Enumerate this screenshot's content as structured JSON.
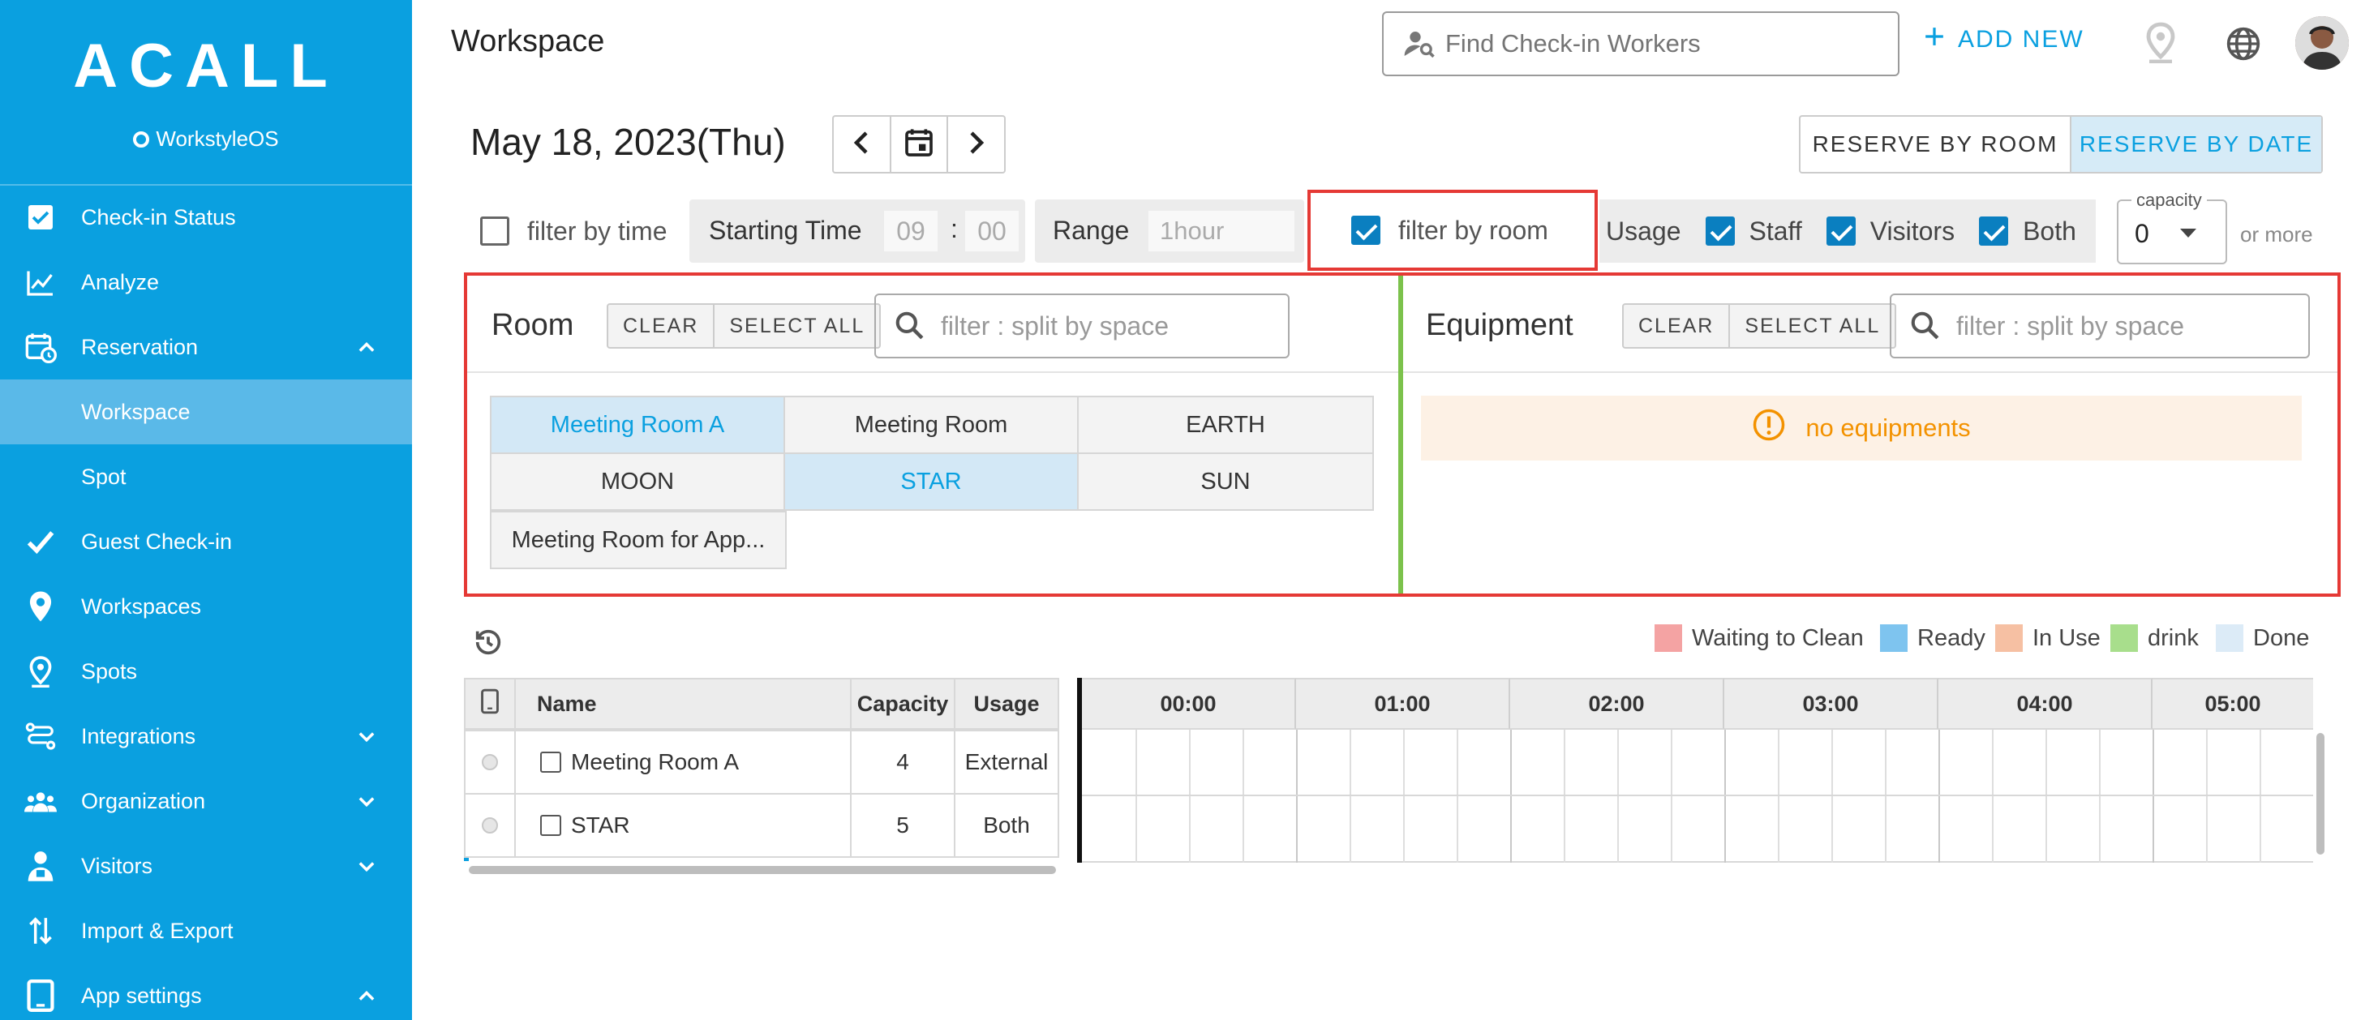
{
  "sidebar": {
    "logo": "ACALL",
    "logo_sub": "WorkstyleOS",
    "items": [
      {
        "label": "Check-in Status",
        "icon": "checkbox-icon"
      },
      {
        "label": "Analyze",
        "icon": "chart-line-icon"
      },
      {
        "label": "Reservation",
        "icon": "calendar-clock-icon",
        "expanded": true
      },
      {
        "label": "Workspace",
        "sub": true,
        "active": true
      },
      {
        "label": "Spot",
        "sub": true
      },
      {
        "label": "Guest Check-in",
        "icon": "check-icon"
      },
      {
        "label": "Workspaces",
        "icon": "map-pin-icon"
      },
      {
        "label": "Spots",
        "icon": "map-pin-outline-icon"
      },
      {
        "label": "Integrations",
        "icon": "integrations-icon",
        "collapsed": true
      },
      {
        "label": "Organization",
        "icon": "people-icon",
        "collapsed": true
      },
      {
        "label": "Visitors",
        "icon": "visitor-icon",
        "collapsed": true
      },
      {
        "label": "Import & Export",
        "icon": "import-export-icon"
      },
      {
        "label": "App settings",
        "icon": "tablet-icon",
        "expanded": true
      }
    ]
  },
  "header": {
    "title": "Workspace",
    "search_placeholder": "Find Check-in Workers",
    "add_new": "ADD NEW"
  },
  "date_bar": {
    "date": "May 18, 2023(Thu)",
    "reserve_by_room": "RESERVE BY ROOM",
    "reserve_by_date": "RESERVE BY DATE"
  },
  "filters": {
    "filter_by_time": "filter by time",
    "starting_time_label": "Starting Time",
    "start_hour": "09",
    "colon": ":",
    "start_min": "00",
    "range_label": "Range",
    "range_value": "1hour",
    "filter_by_room": "filter by room",
    "usage_label": "Usage",
    "usage_staff": "Staff",
    "usage_visitors": "Visitors",
    "usage_both": "Both",
    "capacity_label": "capacity",
    "capacity_value": "0",
    "or_more": "or more"
  },
  "room_panel": {
    "title": "Room",
    "clear": "CLEAR",
    "select_all": "SELECT ALL",
    "search_placeholder": "filter : split by space",
    "rooms": [
      {
        "name": "Meeting Room A",
        "selected": true
      },
      {
        "name": "Meeting Room",
        "selected": false
      },
      {
        "name": "EARTH",
        "selected": false
      },
      {
        "name": "MOON",
        "selected": false
      },
      {
        "name": "STAR",
        "selected": true
      },
      {
        "name": "SUN",
        "selected": false
      },
      {
        "name": "Meeting Room for App...",
        "selected": false
      }
    ]
  },
  "equipment_panel": {
    "title": "Equipment",
    "clear": "CLEAR",
    "select_all": "SELECT ALL",
    "search_placeholder": "filter : split by space",
    "empty_message": "no equipments"
  },
  "legend": [
    {
      "label": "Waiting to Clean",
      "color": "#f4a3a3"
    },
    {
      "label": "Ready",
      "color": "#7ec4ef"
    },
    {
      "label": "In Use",
      "color": "#f6c0a3"
    },
    {
      "label": "drink",
      "color": "#a8de8c"
    },
    {
      "label": "Done",
      "color": "#dcebf7"
    }
  ],
  "table": {
    "headers": {
      "name": "Name",
      "capacity": "Capacity",
      "usage": "Usage"
    },
    "times": [
      "00:00",
      "01:00",
      "02:00",
      "03:00",
      "04:00",
      "05:00"
    ],
    "rows": [
      {
        "name": "Meeting Room A",
        "capacity": "4",
        "usage": "External"
      },
      {
        "name": "STAR",
        "capacity": "5",
        "usage": "Both"
      }
    ]
  },
  "colors": {
    "brand": "#0aa0e0",
    "highlight_border": "#e53935",
    "divider_green": "#7cc24c"
  }
}
